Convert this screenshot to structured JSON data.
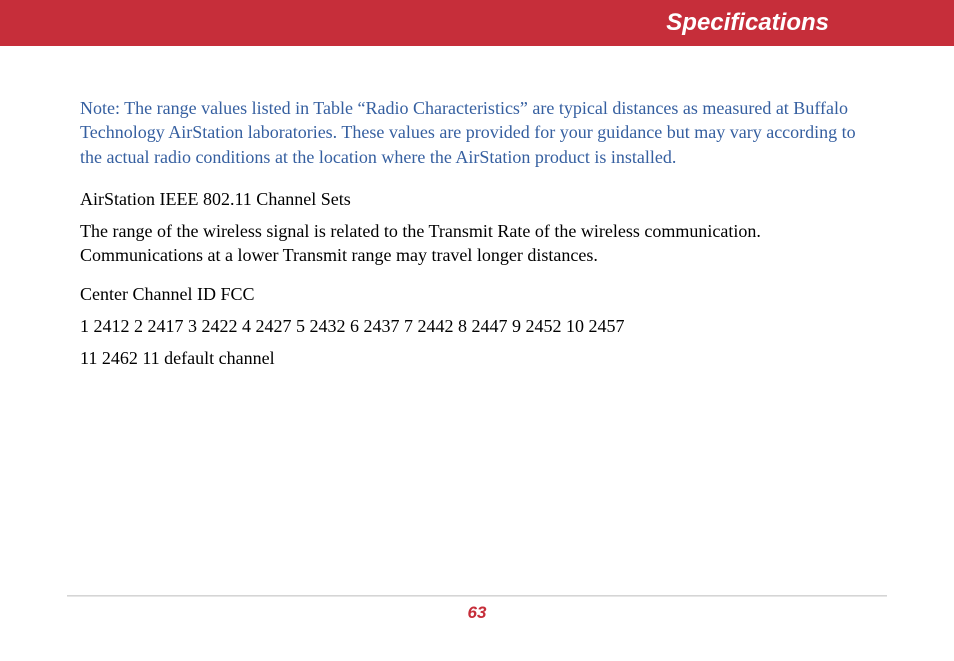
{
  "header": {
    "title": "Specifications"
  },
  "content": {
    "note": "Note: The range values listed in Table “Radio Characteristics” are typical distances as measured at Buffalo Technology AirStation laboratories. These values are provided for your guidance but may vary according to the actual radio conditions at the location where the AirStation product is installed.",
    "heading1": "AirStation IEEE 802.11 Channel Sets",
    "paragraph1": "The range of the wireless signal is related to the Transmit Rate of the wireless communication. Communications at a lower Transmit range may travel longer distances.",
    "heading2": "Center Channel ID FCC",
    "channels_line1": "1 2412  2 2417  3 2422  4 2427  5 2432  6 2437  7 2442  8 2447  9 2452  10 2457",
    "channels_line2": "11 2462 11  default channel"
  },
  "footer": {
    "page_number": "63"
  }
}
